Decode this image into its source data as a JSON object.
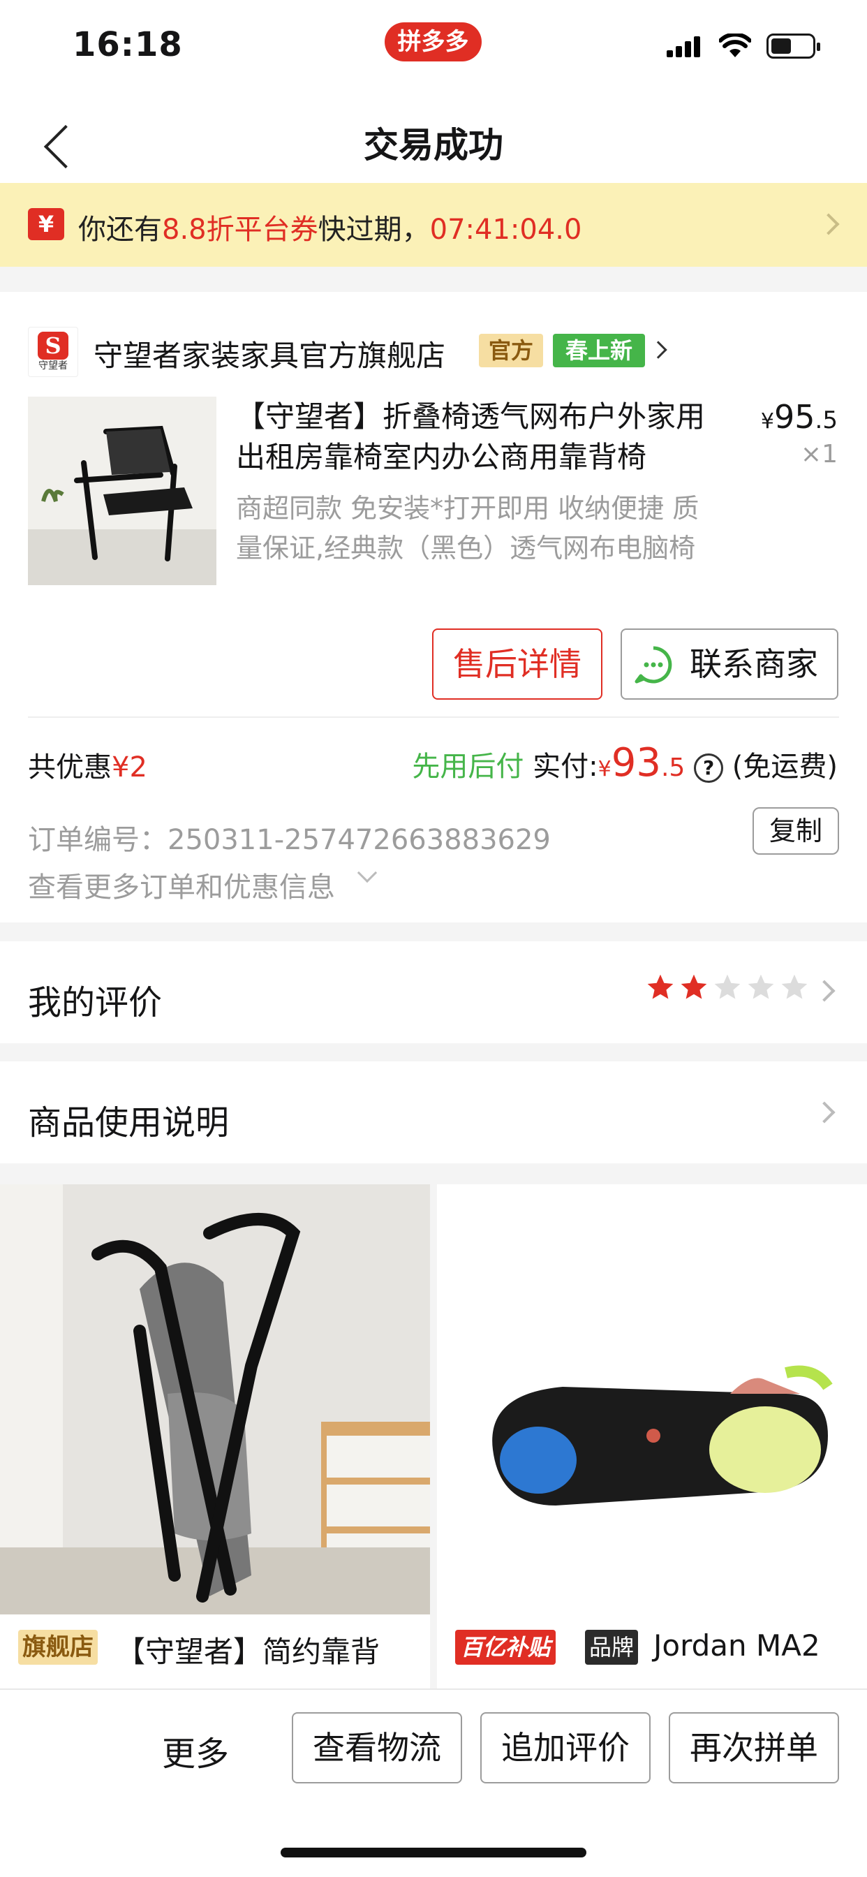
{
  "status_bar": {
    "time": "16:18",
    "app_badge": "拼多多"
  },
  "nav": {
    "title": "交易成功"
  },
  "coupon_banner": {
    "prefix": "你还有",
    "highlight": "8.8折平台券",
    "suffix": "快过期，",
    "countdown": "07:41:04.0"
  },
  "shop": {
    "logo_text": "守望者",
    "name": "守望者家装家具官方旗舰店",
    "tag_official": "官方",
    "tag_new": "春上新"
  },
  "product": {
    "title": "【守望者】折叠椅透气网布户外家用出租房靠椅室内办公商用靠背椅",
    "spec": "商超同款 免安装*打开即用 收纳便捷 质量保证,经典款（黑色）透气网布电脑椅",
    "price_symbol": "¥",
    "price_int": "95",
    "price_dec": ".5",
    "quantity": "×1"
  },
  "actions": {
    "after_sale": "售后详情",
    "contact_seller": "联系商家"
  },
  "summary": {
    "discount_label": "共优惠",
    "discount_value": "¥2",
    "pay_later": "先用后付",
    "paid_label": "实付:",
    "paid_symbol": "¥",
    "paid_int": "93",
    "paid_dec": ".5",
    "info_glyph": "?",
    "shipping": "(免运费)"
  },
  "order": {
    "number_label": "订单编号：",
    "number": "250311-257472663883629",
    "copy_button": "复制",
    "more_info": "查看更多订单和优惠信息"
  },
  "review": {
    "title": "我的评价",
    "rating": 2,
    "max_rating": 5
  },
  "usage": {
    "title": "商品使用说明"
  },
  "recommendations": [
    {
      "badge": "旗舰店",
      "title": "【守望者】简约靠背"
    },
    {
      "badge": "百亿补贴",
      "brand_badge": "品牌",
      "title": "Jordan MA2"
    }
  ],
  "bottom_bar": {
    "more": "更多",
    "logistics": "查看物流",
    "add_review": "追加评价",
    "reorder": "再次拼单"
  },
  "colors": {
    "brand_red": "#e02e24",
    "banner_bg": "#fbf1b7",
    "green": "#45b549",
    "star_active": "#e02e24",
    "star_inactive": "#dcdcdc"
  }
}
